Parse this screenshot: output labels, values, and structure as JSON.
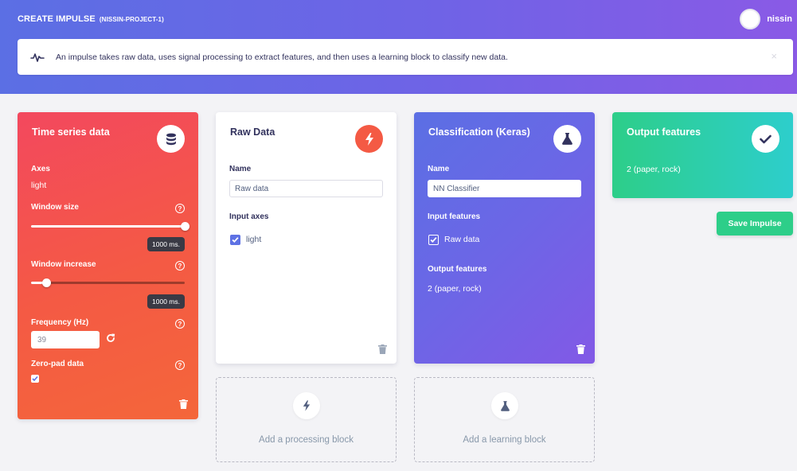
{
  "header": {
    "title": "CREATE IMPULSE",
    "project": "(NISSIN-PROJECT-1)",
    "username": "nissin",
    "info": "An impulse takes raw data, uses signal processing to extract features, and then uses a learning block to classify new data.",
    "colors": {
      "gradient_start": "#5b6fe4",
      "gradient_end": "#8a5ae6"
    }
  },
  "time_series": {
    "title": "Time series data",
    "axes_label": "Axes",
    "axes_value": "light",
    "window_size_label": "Window size",
    "window_size_value": "1000 ms.",
    "window_size_fraction": 1.0,
    "window_increase_label": "Window increase",
    "window_increase_value": "1000 ms.",
    "window_increase_fraction": 0.1,
    "frequency_label": "Frequency (Hz)",
    "frequency_value": "39",
    "zero_pad_label": "Zero-pad data",
    "zero_pad_checked": true,
    "color": "#f3485e"
  },
  "raw_data": {
    "title": "Raw Data",
    "name_label": "Name",
    "name_value": "Raw data",
    "input_axes_label": "Input axes",
    "axis_item": "light",
    "color": "#f45a44"
  },
  "classification": {
    "title": "Classification (Keras)",
    "name_label": "Name",
    "name_value": "NN Classifier",
    "input_features_label": "Input features",
    "input_feature_item": "Raw data",
    "output_features_label": "Output features",
    "output_features_value": "2 (paper, rock)",
    "color": "#6c66e6"
  },
  "output": {
    "title": "Output features",
    "value": "2 (paper, rock)",
    "color": "#2dce89"
  },
  "actions": {
    "save": "Save Impulse"
  },
  "add_blocks": {
    "processing": "Add a processing block",
    "learning": "Add a learning block"
  },
  "icons": [
    "pulse-icon",
    "database-icon",
    "bolt-icon",
    "flask-icon",
    "check-icon",
    "help-icon",
    "refresh-icon",
    "trash-icon",
    "checkbox-icon",
    "avatar"
  ]
}
